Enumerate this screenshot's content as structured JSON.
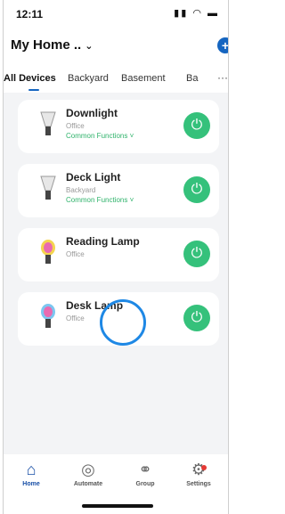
{
  "status": {
    "time": "12:11",
    "icons": "signal wifi battery"
  },
  "header": {
    "title": "My Home ..",
    "add_label": "+"
  },
  "tabs": [
    {
      "label": "All Devices"
    },
    {
      "label": "Backyard"
    },
    {
      "label": "Basement"
    },
    {
      "label": "Ba"
    }
  ],
  "tabs_more": "···",
  "devices": [
    {
      "name": "Downlight",
      "room": "Office",
      "functions": "Common Functions ˅"
    },
    {
      "name": "Deck Light",
      "room": "Backyard",
      "functions": "Common Functions ˅"
    },
    {
      "name": "Reading Lamp",
      "room": "Office"
    },
    {
      "name": "Desk Lamp",
      "room": "Office"
    }
  ],
  "power_icon": "⏻",
  "nav": {
    "home": "Home",
    "automate": "Automate",
    "group": "Group",
    "settings": "Settings"
  },
  "colors": {
    "accent": "#1565c0",
    "power": "#35c17b",
    "touch_indicator": "#1e88e5"
  }
}
